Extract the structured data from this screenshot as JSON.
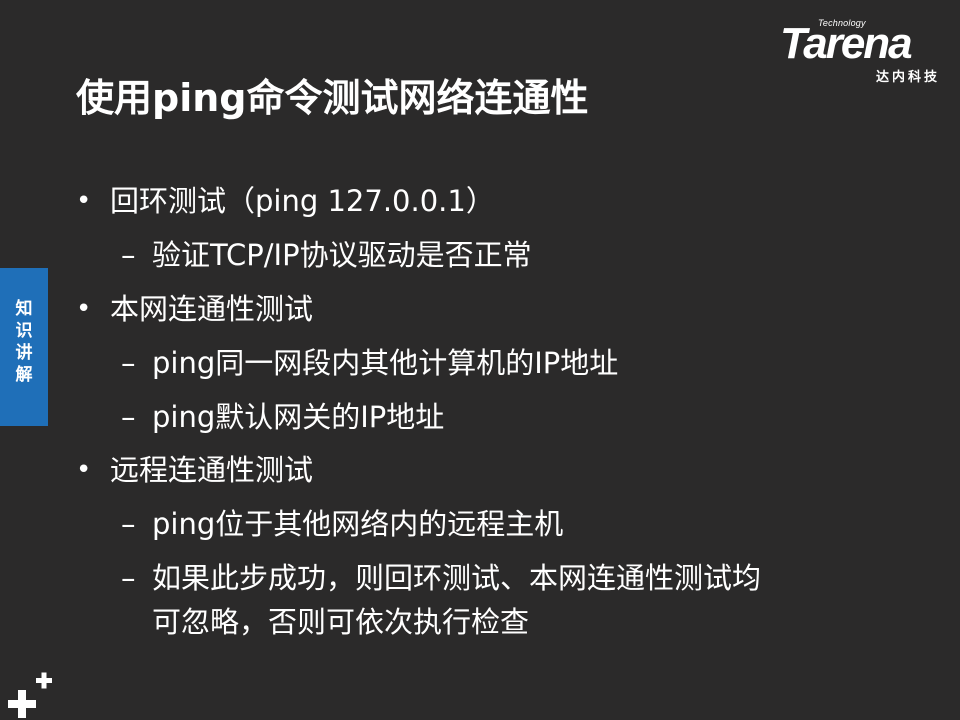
{
  "logo": {
    "technology": "Technology",
    "wordmark": "Tarena",
    "subtitle": "达内科技"
  },
  "title": "使用ping命令测试网络连通性",
  "side_tab": {
    "label": "知\n识\n讲\n解"
  },
  "content": {
    "b1": "回环测试（ping 127.0.0.1）",
    "b1_s1": "验证TCP/IP协议驱动是否正常",
    "b2": "本网连通性测试",
    "b2_s1": "ping同一网段内其他计算机的IP地址",
    "b2_s2": "ping默认网关的IP地址",
    "b3": "远程连通性测试",
    "b3_s1": "ping位于其他网络内的远程主机",
    "b3_s2_line1": "如果此步成功，则回环测试、本网连通性测试均",
    "b3_s2_line2": "可忽略，否则可依次执行检查",
    "bullet_symbol": "•",
    "dash_symbol": "–"
  },
  "colors": {
    "background": "#2b2a2a",
    "side_tab": "#1f6fb8",
    "text": "#ffffff"
  },
  "icons": [
    "plus-icon"
  ]
}
